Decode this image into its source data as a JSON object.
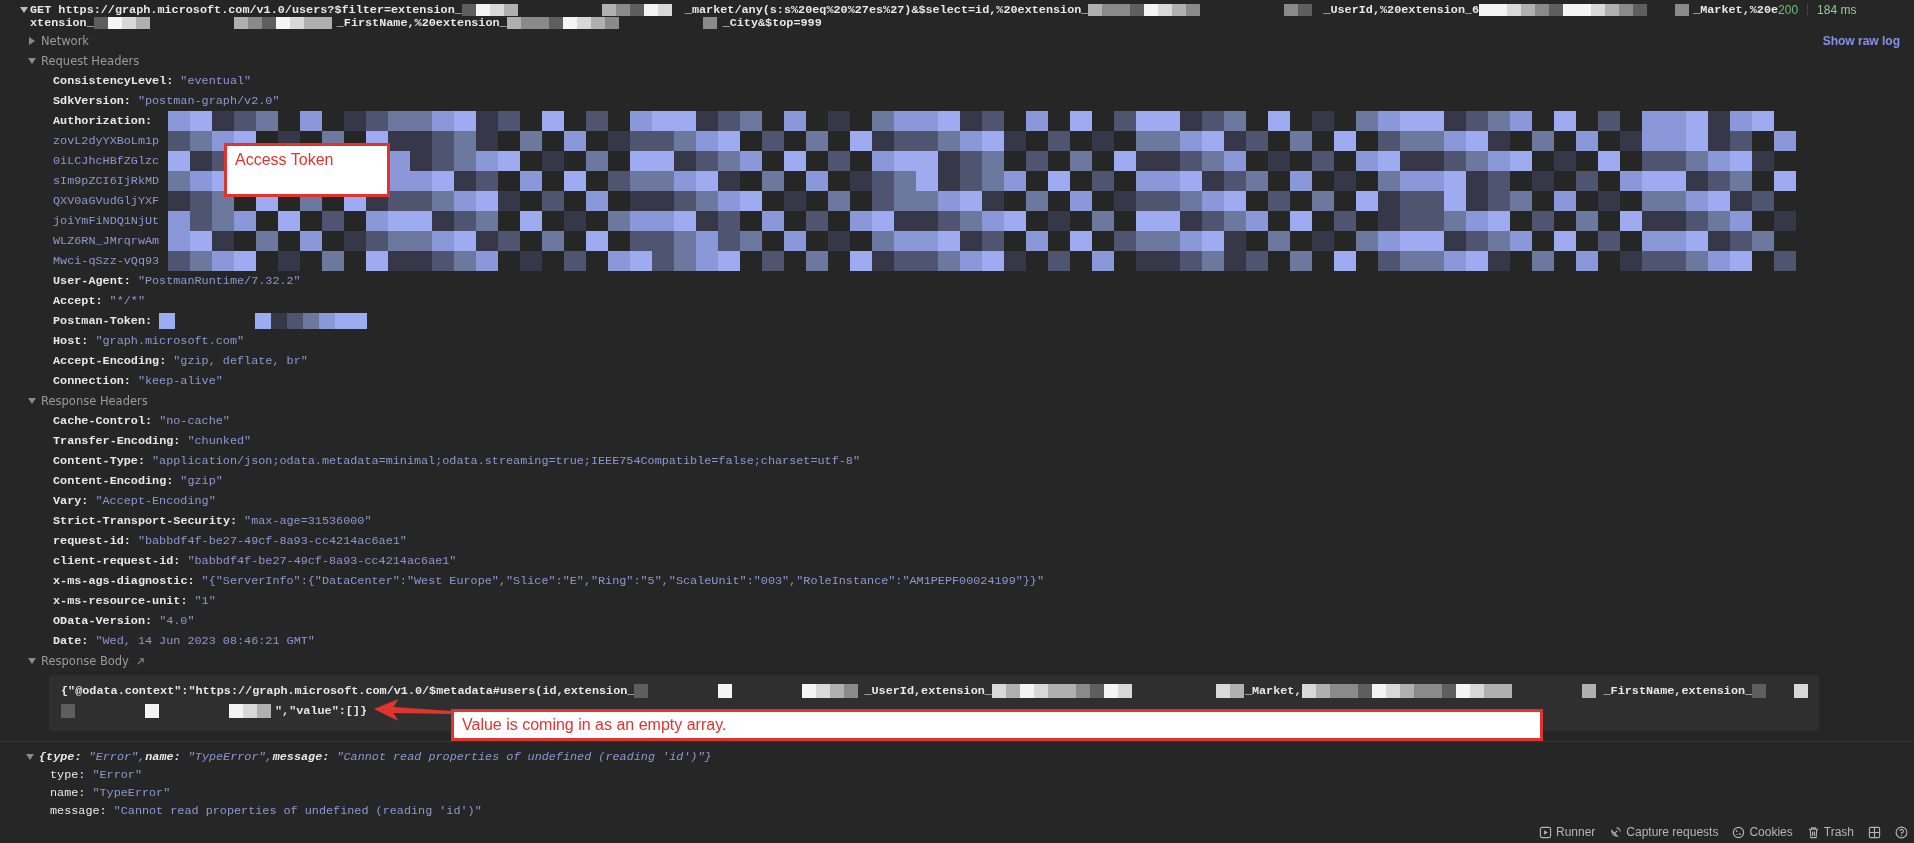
{
  "request": {
    "expanded": true,
    "url_lines": [
      [
        {
          "kind": "text",
          "text": "GET https://graph.microsoft.com/v1.0/users?$filter=extension_"
        },
        {
          "kind": "redacted"
        },
        {
          "kind": "text",
          "text": "_market/any(s:s%20eq%20%27es%27)&$select=id,%20extension_"
        },
        {
          "kind": "redacted"
        },
        {
          "kind": "text",
          "text": "_UserId,%20extension_6"
        },
        {
          "kind": "redacted"
        },
        {
          "kind": "text",
          "text": "_Market,%20e"
        }
      ],
      [
        {
          "kind": "text",
          "text": "xtension_"
        },
        {
          "kind": "redacted"
        },
        {
          "kind": "text",
          "text": "_FirstName,%20extension_"
        },
        {
          "kind": "redacted"
        },
        {
          "kind": "text",
          "text": "_City&$top=999"
        }
      ]
    ],
    "status": "200",
    "time": "184 ms"
  },
  "network": {
    "label": "Network",
    "expanded": false
  },
  "show_raw_log": "Show raw log",
  "request_headers": {
    "label": "Request Headers",
    "expanded": true,
    "items": [
      {
        "kind": "text",
        "name": "ConsistencyLevel:",
        "value": "\"eventual\""
      },
      {
        "kind": "text",
        "name": "SdkVersion:",
        "value": "\"postman-graph/v2.0\""
      },
      {
        "kind": "token",
        "name": "Authorization:",
        "lines": [
          "zovL2dyYXBoLm1p",
          "0iLCJhcHBfZGlzc",
          "sIm9pZCI6IjRkMD",
          "QXV0aGVudGljYXF",
          "joiYmFiNDQ1NjUt",
          "WLZ6RN_JMrqrwAm",
          "Mwci-qSzz-vQq93"
        ]
      },
      {
        "kind": "text",
        "name": "User-Agent:",
        "value": "\"PostmanRuntime/7.32.2\""
      },
      {
        "kind": "text",
        "name": "Accept:",
        "value": "\"*/*\""
      },
      {
        "kind": "redacted",
        "name": "Postman-Token:"
      },
      {
        "kind": "text",
        "name": "Host:",
        "value": "\"graph.microsoft.com\""
      },
      {
        "kind": "text",
        "name": "Accept-Encoding:",
        "value": "\"gzip, deflate, br\""
      },
      {
        "kind": "text",
        "name": "Connection:",
        "value": "\"keep-alive\""
      }
    ]
  },
  "response_headers": {
    "label": "Response Headers",
    "expanded": true,
    "items": [
      {
        "kind": "text",
        "name": "Cache-Control:",
        "value": "\"no-cache\""
      },
      {
        "kind": "text",
        "name": "Transfer-Encoding:",
        "value": "\"chunked\""
      },
      {
        "kind": "text",
        "name": "Content-Type:",
        "value": "\"application/json;odata.metadata=minimal;odata.streaming=true;IEEE754Compatible=false;charset=utf-8\""
      },
      {
        "kind": "text",
        "name": "Content-Encoding:",
        "value": "\"gzip\""
      },
      {
        "kind": "text",
        "name": "Vary:",
        "value": "\"Accept-Encoding\""
      },
      {
        "kind": "text",
        "name": "Strict-Transport-Security:",
        "value": "\"max-age=31536000\""
      },
      {
        "kind": "text",
        "name": "request-id:",
        "value": "\"babbdf4f-be27-49cf-8a93-cc4214ac6ae1\""
      },
      {
        "kind": "text",
        "name": "client-request-id:",
        "value": "\"babbdf4f-be27-49cf-8a93-cc4214ac6ae1\""
      },
      {
        "kind": "text",
        "name": "x-ms-ags-diagnostic:",
        "value": "\"{\"ServerInfo\":{\"DataCenter\":\"West Europe\",\"Slice\":\"E\",\"Ring\":\"5\",\"ScaleUnit\":\"003\",\"RoleInstance\":\"AM1PEPF00024199\"}}\""
      },
      {
        "kind": "text",
        "name": "x-ms-resource-unit:",
        "value": "\"1\""
      },
      {
        "kind": "text",
        "name": "OData-Version:",
        "value": "\"4.0\""
      },
      {
        "kind": "text",
        "name": "Date:",
        "value": "\"Wed, 14 Jun 2023 08:46:21 GMT\""
      }
    ]
  },
  "response_body": {
    "label": "Response Body",
    "expanded": true,
    "lines": [
      [
        {
          "kind": "text",
          "text": "{\"@odata.context\":\"https://graph.microsoft.com/v1.0/$metadata#users(id,extension_"
        },
        {
          "kind": "redacted"
        },
        {
          "kind": "text",
          "text": "_UserId,extension_"
        },
        {
          "kind": "redacted"
        },
        {
          "kind": "text",
          "text": "_Market,"
        },
        {
          "kind": "redacted"
        },
        {
          "kind": "text",
          "text": "_FirstName,extension_"
        },
        {
          "kind": "redacted"
        }
      ],
      [
        {
          "kind": "redacted"
        },
        {
          "kind": "text",
          "text": "\",\"value\":[]}"
        }
      ]
    ]
  },
  "annotations": [
    {
      "text": "Access Token"
    },
    {
      "text": "Value is coming in as an empty array."
    }
  ],
  "error": {
    "expanded": true,
    "summary": [
      {
        "key": "{type:",
        "value": "\"Error\","
      },
      {
        "key": "name:",
        "value": "\"TypeError\","
      },
      {
        "key": "message:",
        "value": "\"Cannot read properties of undefined (reading 'id')\"}"
      }
    ],
    "fields": [
      {
        "name": "type:",
        "value": "\"Error\""
      },
      {
        "name": "name:",
        "value": "\"TypeError\""
      },
      {
        "name": "message:",
        "value": "\"Cannot read properties of undefined (reading 'id')\""
      }
    ]
  },
  "footer": {
    "items": [
      {
        "kind": "runner",
        "label": "Runner"
      },
      {
        "kind": "capture",
        "label": "Capture requests"
      },
      {
        "kind": "cookies",
        "label": "Cookies"
      },
      {
        "kind": "trash",
        "label": "Trash"
      }
    ]
  }
}
